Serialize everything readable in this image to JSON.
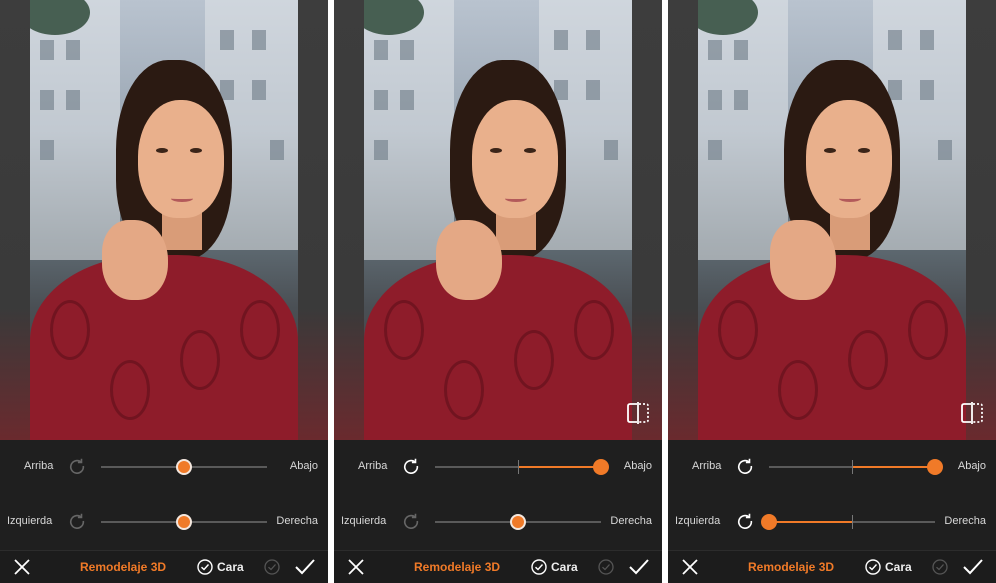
{
  "colors": {
    "accent": "#f07a28",
    "panel_bg": "#1f1f1f",
    "text": "#d8d8d8"
  },
  "panels": [
    {
      "vertical": {
        "left_label": "Arriba",
        "right_label": "Abajo",
        "value_percent": 50,
        "reset_enabled": false
      },
      "horizontal": {
        "left_label": "Izquierda",
        "right_label": "Derecha",
        "value_percent": 50,
        "reset_enabled": false
      },
      "show_compare_icon": false,
      "toolbar": {
        "title": "Remodelaje 3D",
        "face_label": "Cara"
      }
    },
    {
      "vertical": {
        "left_label": "Arriba",
        "right_label": "Abajo",
        "value_percent": 100,
        "reset_enabled": true
      },
      "horizontal": {
        "left_label": "Izquierda",
        "right_label": "Derecha",
        "value_percent": 50,
        "reset_enabled": false
      },
      "show_compare_icon": true,
      "toolbar": {
        "title": "Remodelaje 3D",
        "face_label": "Cara"
      }
    },
    {
      "vertical": {
        "left_label": "Arriba",
        "right_label": "Abajo",
        "value_percent": 100,
        "reset_enabled": true
      },
      "horizontal": {
        "left_label": "Izquierda",
        "right_label": "Derecha",
        "value_percent": 0,
        "reset_enabled": true
      },
      "show_compare_icon": true,
      "toolbar": {
        "title": "Remodelaje 3D",
        "face_label": "Cara"
      }
    }
  ],
  "icons": {
    "reset": "rotate-cw-icon",
    "compare": "split-compare-icon",
    "close": "close-icon",
    "face": "check-circle-icon",
    "apply": "checkmark-icon"
  }
}
